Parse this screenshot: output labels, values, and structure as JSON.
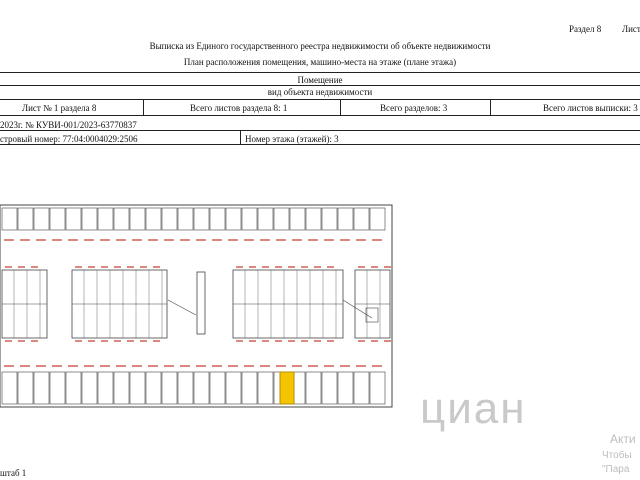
{
  "header": {
    "section": "Раздел 8",
    "sheet_fragment": "Лист",
    "title1": "Выписка из Единого государственного реестра недвижимости об объекте недвижимости",
    "title2": "План расположения помещения, машино-места на этаже (плане этажа)"
  },
  "object": {
    "type": "Помещение",
    "type_caption": "вид объекта недвижимости"
  },
  "sheets": {
    "sheet_no": "Лист № 1 раздела 8",
    "total_section": "Всего листов раздела 8: 1",
    "total_sections": "Всего разделов: 3",
    "total_extract": "Всего листов выписки: 3"
  },
  "record": {
    "ref": "2023г. № КУВИ-001/2023-63770837",
    "cadastral": "стровый номер: 77:04:0004029:2506",
    "floor": "Номер этажа (этажей): 3"
  },
  "plan": {
    "highlight_color": "#f4c400",
    "line_color": "#444444",
    "red_color": "#c0392b"
  },
  "footer": {
    "scale": "штаб 1"
  },
  "overlay": {
    "watermark": "циан",
    "activate_1": "Акти",
    "activate_2": "Чтобы",
    "activate_3": "\"Пара"
  }
}
